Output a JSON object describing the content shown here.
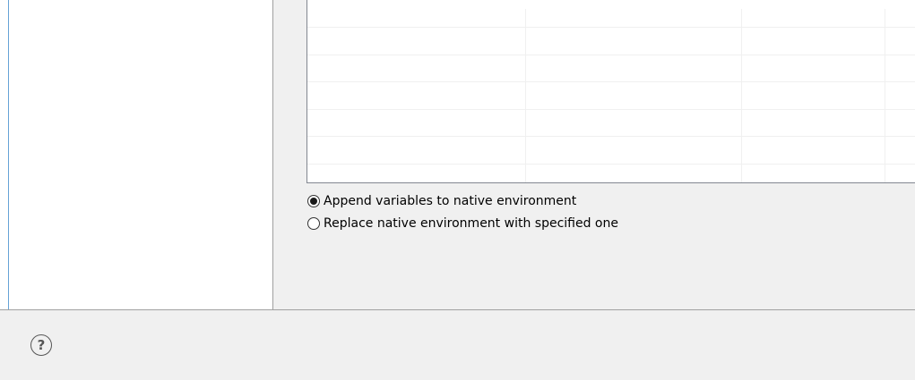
{
  "environment": {
    "options": [
      {
        "label": "Append variables to native environment",
        "checked": true
      },
      {
        "label": "Replace native environment with specified one",
        "checked": false
      }
    ]
  },
  "footer": {
    "help_glyph": "?"
  },
  "colors": {
    "accent": "#66a3d6",
    "panel": "#f0f0f0",
    "table_border": "#828790"
  },
  "icons": {
    "help": "help-question-icon"
  }
}
